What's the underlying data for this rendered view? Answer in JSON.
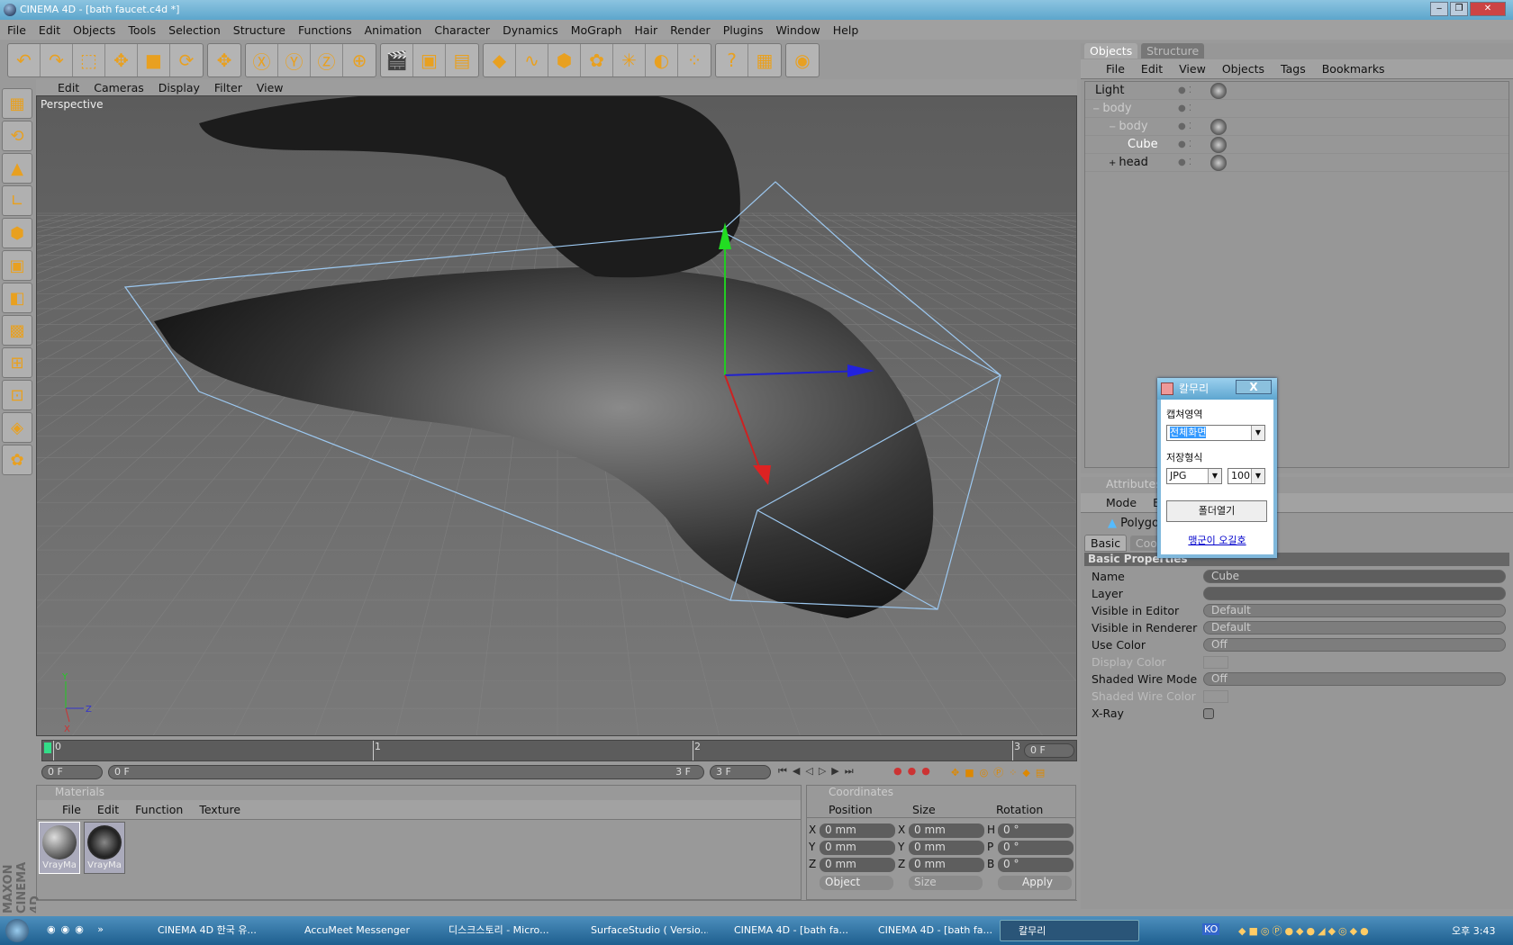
{
  "window": {
    "title": "CINEMA 4D - [bath faucet.c4d *]",
    "minimize": "‒",
    "restore": "❐",
    "close": "✕"
  },
  "menubar": [
    "File",
    "Edit",
    "Objects",
    "Tools",
    "Selection",
    "Structure",
    "Functions",
    "Animation",
    "Character",
    "Dynamics",
    "MoGraph",
    "Hair",
    "Render",
    "Plugins",
    "Window",
    "Help"
  ],
  "toolbar": {
    "groups": [
      [
        "undo-icon",
        "redo-icon",
        "live-selection-icon",
        "move-icon",
        "scale-icon",
        "rotate-icon"
      ],
      [
        "move-axis-icon"
      ],
      [
        "x-axis-icon",
        "y-axis-icon",
        "z-axis-icon",
        "world-coordinates-icon"
      ],
      [
        "render-view-icon",
        "render-picture-viewer-icon",
        "render-settings-icon"
      ],
      [
        "cube-primitive-icon",
        "spline-icon",
        "nurbs-icon",
        "array-icon",
        "deformer-icon",
        "scene-icon",
        "particle-icon"
      ],
      [
        "help-cursor-icon",
        "script-help-icon"
      ],
      [
        "browser-icon"
      ]
    ]
  },
  "left_tools": [
    "layout-icon",
    "undo-view-icon",
    "points-mode-icon",
    "edges-mode-icon",
    "polygons-mode-icon",
    "object-mode-icon",
    "model-mode-icon",
    "texture-mode-icon",
    "axis-mode-icon",
    "tweak-mode-icon",
    "animation-icon",
    "sculpt-icon"
  ],
  "viewport": {
    "menu": [
      "Edit",
      "Cameras",
      "Display",
      "Filter",
      "View"
    ],
    "label": "Perspective",
    "axes": {
      "y": "Y",
      "z": "Z",
      "x": "X"
    }
  },
  "objects_panel": {
    "tabs": [
      "Objects",
      "Structure"
    ],
    "menu": [
      "File",
      "Edit",
      "View",
      "Objects",
      "Tags",
      "Bookmarks"
    ],
    "items": [
      {
        "name": "Light",
        "depth": 0,
        "expand": ""
      },
      {
        "name": "body",
        "depth": 0,
        "expand": "−"
      },
      {
        "name": "body",
        "depth": 1,
        "expand": "−"
      },
      {
        "name": "Cube",
        "depth": 2,
        "expand": ""
      },
      {
        "name": "head",
        "depth": 1,
        "expand": "+"
      }
    ]
  },
  "attributes_panel": {
    "title": "Attributes",
    "menu": [
      "Mode",
      "Ed"
    ],
    "object_type": "Polygon O",
    "tabs": [
      "Basic",
      "Coord"
    ],
    "section": "Basic Properties",
    "properties": [
      {
        "label": "Name",
        "value": "Cube"
      },
      {
        "label": "Layer",
        "value": ""
      },
      {
        "label": "Visible in Editor",
        "value": "Default"
      },
      {
        "label": "Visible in Renderer",
        "value": "Default"
      },
      {
        "label": "Use Color",
        "value": "Off"
      },
      {
        "label": "Display Color",
        "value": ""
      },
      {
        "label": "Shaded Wire Mode",
        "value": "Off"
      },
      {
        "label": "Shaded Wire Color",
        "value": ""
      },
      {
        "label": "X-Ray",
        "value": ""
      }
    ]
  },
  "timeline": {
    "ticks": [
      "0",
      "1",
      "2",
      "3"
    ],
    "current_frame": "0 F",
    "start": "0 F",
    "range_start": "0 F",
    "range_end": "3 F",
    "end": "3 F"
  },
  "materials_panel": {
    "title": "Materials",
    "menu": [
      "File",
      "Edit",
      "Function",
      "Texture"
    ],
    "materials": [
      "VrayMa",
      "VrayMa"
    ]
  },
  "coordinates_panel": {
    "title": "Coordinates",
    "headers": [
      "Position",
      "Size",
      "Rotation"
    ],
    "rows": [
      {
        "a": "X",
        "p": "0 mm",
        "b": "X",
        "s": "0 mm",
        "c": "H",
        "r": "0 °"
      },
      {
        "a": "Y",
        "p": "0 mm",
        "b": "Y",
        "s": "0 mm",
        "c": "P",
        "r": "0 °"
      },
      {
        "a": "Z",
        "p": "0 mm",
        "b": "Z",
        "s": "0 mm",
        "c": "B",
        "r": "0 °"
      }
    ],
    "mode": "Object",
    "size_mode": "Size",
    "apply": "Apply"
  },
  "brand": "MAXON CINEMA 4D",
  "dialog": {
    "title": "칼무리",
    "close": "X",
    "capture_label": "캡쳐영역",
    "capture_value": "전체화면",
    "format_label": "저장형식",
    "format_value": "JPG",
    "quality_value": "100",
    "open_folder": "폴더열기",
    "link": "맹군이 오길호"
  },
  "taskbar": {
    "tasks": [
      "CINEMA 4D 한국 유...",
      "AccuMeet Messenger",
      "디스크스토리 - Micro...",
      "SurfaceStudio ( Versio...",
      "CINEMA 4D - [bath fa...",
      "CINEMA 4D - [bath fa...",
      "칼무리"
    ],
    "ime": "KO",
    "clock": "오후 3:43"
  }
}
